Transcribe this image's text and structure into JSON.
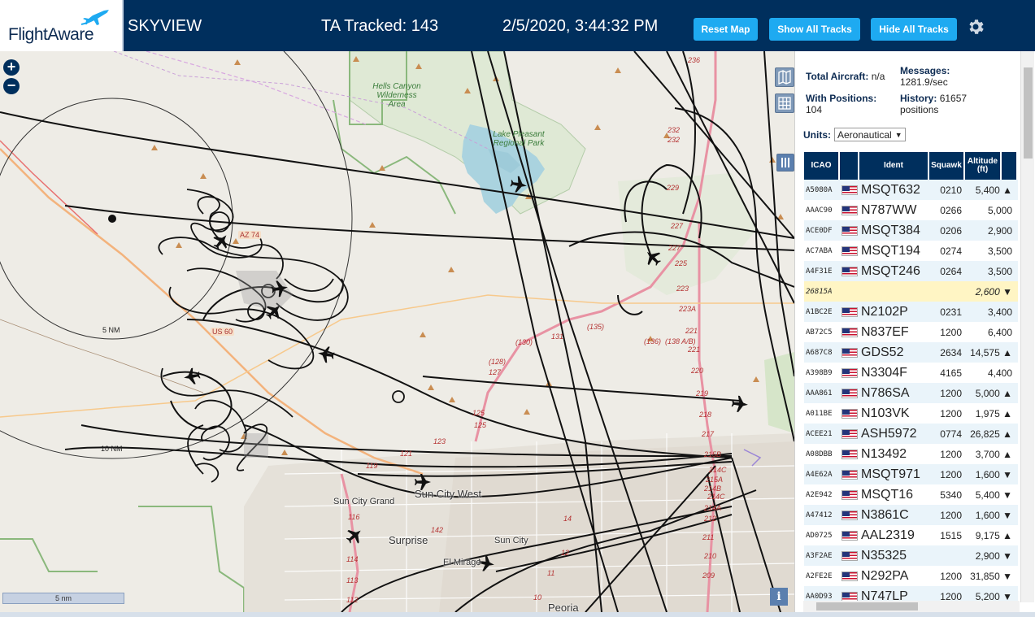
{
  "header": {
    "logo_text": "FlightAware",
    "app_title": "SKYVIEW",
    "ta_tracked": "TA Tracked: 143",
    "datetime": "2/5/2020, 3:44:32 PM",
    "reset_map": "Reset Map",
    "show_all_tracks": "Show All Tracks",
    "hide_all_tracks": "Hide All Tracks"
  },
  "map": {
    "zoom_in": "+",
    "zoom_out": "−",
    "scale_label": "5 nm",
    "info_label": "i",
    "ring_labels": [
      "5 NM",
      "10 NM"
    ],
    "area_labels": [
      "Hells Canyon Wilderness Area",
      "Lake Pleasant Regional Park"
    ],
    "cities": [
      "Sun City West",
      "Sun City Grand",
      "Surprise",
      "Sun City",
      "El Mirage",
      "Peoria"
    ],
    "highway_labels": [
      "AZ 74",
      "US 60"
    ],
    "mile_markers": [
      "236",
      "232",
      "232",
      "229",
      "227",
      "227",
      "225",
      "223",
      "223A",
      "221",
      "221",
      "220",
      "219",
      "218",
      "217",
      "215B",
      "214C",
      "215A",
      "214B",
      "214C",
      "214A",
      "212",
      "211",
      "210",
      "209",
      "131",
      "(130)",
      "(135)",
      "(136)",
      "(138 A/B)",
      "(128)",
      "127",
      "125",
      "125",
      "123",
      "121",
      "119",
      "116",
      "114",
      "113",
      "112",
      "142",
      "14",
      "12",
      "11",
      "10"
    ]
  },
  "stats": {
    "total_aircraft_label": "Total Aircraft:",
    "total_aircraft_value": "n/a",
    "messages_label": "Messages:",
    "messages_value": "1281.9/sec",
    "with_positions_label": "With Positions:",
    "with_positions_value": "104",
    "history_label": "History:",
    "history_value": "61657 positions",
    "units_label": "Units:",
    "units_value": "Aeronautical"
  },
  "table": {
    "headers": [
      "ICAO",
      "",
      "Ident",
      "Squawk",
      "Altitude (ft)"
    ],
    "rows": [
      {
        "icao": "A5080A",
        "flag": true,
        "ident": "MSQT632",
        "squawk": "0210",
        "alt": "5,400 ▲"
      },
      {
        "icao": "AAAC90",
        "flag": true,
        "ident": "N787WW",
        "squawk": "0266",
        "alt": "5,000"
      },
      {
        "icao": "ACE0DF",
        "flag": true,
        "ident": "MSQT384",
        "squawk": "0206",
        "alt": "2,900"
      },
      {
        "icao": "AC7ABA",
        "flag": true,
        "ident": "MSQT194",
        "squawk": "0274",
        "alt": "3,500"
      },
      {
        "icao": "A4F31E",
        "flag": true,
        "ident": "MSQT246",
        "squawk": "0264",
        "alt": "3,500"
      },
      {
        "icao": "26815A",
        "flag": false,
        "ident": "",
        "squawk": "",
        "alt": "2,600 ▼",
        "selected": true
      },
      {
        "icao": "A1BC2E",
        "flag": true,
        "ident": "N2102P",
        "squawk": "0231",
        "alt": "3,400"
      },
      {
        "icao": "AB72C5",
        "flag": true,
        "ident": "N837EF",
        "squawk": "1200",
        "alt": "6,400"
      },
      {
        "icao": "A687C8",
        "flag": true,
        "ident": "GDS52",
        "squawk": "2634",
        "alt": "14,575 ▲"
      },
      {
        "icao": "A398B9",
        "flag": true,
        "ident": "N3304F",
        "squawk": "4165",
        "alt": "4,400"
      },
      {
        "icao": "AAA861",
        "flag": true,
        "ident": "N786SA",
        "squawk": "1200",
        "alt": "5,000 ▲"
      },
      {
        "icao": "A011BE",
        "flag": true,
        "ident": "N103VK",
        "squawk": "1200",
        "alt": "1,975 ▲"
      },
      {
        "icao": "ACEE21",
        "flag": true,
        "ident": "ASH5972",
        "squawk": "0774",
        "alt": "26,825 ▲"
      },
      {
        "icao": "A08DBB",
        "flag": true,
        "ident": "N13492",
        "squawk": "1200",
        "alt": "3,700 ▲"
      },
      {
        "icao": "A4E62A",
        "flag": true,
        "ident": "MSQT971",
        "squawk": "1200",
        "alt": "1,600 ▼"
      },
      {
        "icao": "A2E942",
        "flag": true,
        "ident": "MSQT16",
        "squawk": "5340",
        "alt": "5,400 ▼"
      },
      {
        "icao": "A47412",
        "flag": true,
        "ident": "N3861C",
        "squawk": "1200",
        "alt": "1,600 ▼"
      },
      {
        "icao": "AD0725",
        "flag": true,
        "ident": "AAL2319",
        "squawk": "1515",
        "alt": "9,175 ▲"
      },
      {
        "icao": "A3F2AE",
        "flag": true,
        "ident": "N35325",
        "squawk": "",
        "alt": "2,900 ▼"
      },
      {
        "icao": "A2FE2E",
        "flag": true,
        "ident": "N292PA",
        "squawk": "1200",
        "alt": "31,850 ▼"
      },
      {
        "icao": "AA0D93",
        "flag": true,
        "ident": "N747LP",
        "squawk": "1200",
        "alt": "5,200 ▼"
      }
    ]
  },
  "colors": {
    "header_bg": "#002f5d",
    "button_bg": "#1eaaf1",
    "row_alt": "#eaf4fa",
    "row_selected": "#fff5c4"
  },
  "icons": [
    "gear-icon",
    "flightaware-plane-logo",
    "layers-icon",
    "grid-icon",
    "columns-icon",
    "us-flag-icon",
    "aircraft-icon"
  ]
}
